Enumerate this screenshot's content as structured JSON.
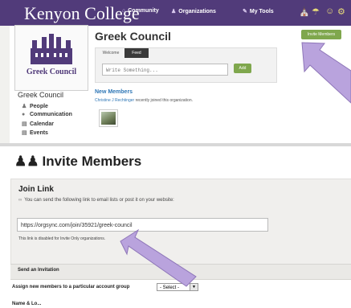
{
  "top": {
    "brand": "Kenyon College",
    "nav": [
      "Community",
      "Organizations",
      "My Tools"
    ]
  },
  "org": {
    "logo_text": "Greek Council",
    "name": "Greek Council",
    "sidebar": [
      "People",
      "Communication",
      "Calendar",
      "Events"
    ],
    "page_title": "Greek Council",
    "invite_button": "Invite Members",
    "tabs": [
      "Welcome",
      "Feed"
    ],
    "write_placeholder": "Write Something...",
    "add_button": "Add",
    "new_members_title": "New Members",
    "joined_name": "Christine J Rechtinger",
    "joined_text": "recently joined this organization."
  },
  "invite": {
    "title": "Invite Members",
    "join_link_title": "Join Link",
    "join_link_desc": "You can send the following link to email lists or post it on your website:",
    "url": "https://orgsync.com/join/35921/greek-council",
    "note": "This link is disabled for Invite Only organizations.",
    "send_invitation": "Send an Invitation",
    "assign_label": "Assign new members to a particular account group",
    "select_value": "- Select -",
    "next_label": "Name & Lo..."
  },
  "colors": {
    "topbar": "#513b7a",
    "button_green": "#7fa74d",
    "link_blue": "#2f77b6",
    "arrow": "#b9a3dd"
  }
}
